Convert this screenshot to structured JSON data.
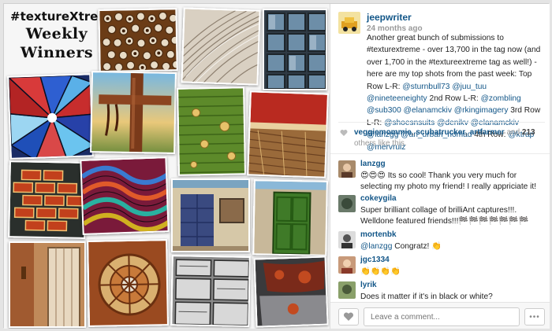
{
  "collage": {
    "title_line1": "#textureXtreme",
    "title_line2": "Weekly",
    "title_line3": "Winners"
  },
  "post": {
    "author": "jeepwriter",
    "time_ago": "24 months ago",
    "caption_parts": [
      {
        "t": "Another great bunch of submissions to #texturextreme - over 13,700 in the tag now (and over 1,700 in the #textureextreme tag as well!) - here are my top shots from the past week: Top Row L-R: ",
        "m": false
      },
      {
        "t": "@sturnbull73",
        "m": true
      },
      {
        "t": " ",
        "m": false
      },
      {
        "t": "@juu_tuu",
        "m": true
      },
      {
        "t": " ",
        "m": false
      },
      {
        "t": "@nineteeneighty",
        "m": true
      },
      {
        "t": " 2nd Row L-R: ",
        "m": false
      },
      {
        "t": "@zombling",
        "m": true
      },
      {
        "t": " ",
        "m": false
      },
      {
        "t": "@sub300",
        "m": true
      },
      {
        "t": " ",
        "m": false
      },
      {
        "t": "@elanamckiv",
        "m": true
      },
      {
        "t": " ",
        "m": false
      },
      {
        "t": "@rkingimagery",
        "m": true
      },
      {
        "t": " 3rd Row L-R: ",
        "m": false
      },
      {
        "t": "@shoesnsuits",
        "m": true
      },
      {
        "t": " ",
        "m": false
      },
      {
        "t": "@denikv",
        "m": true
      },
      {
        "t": " ",
        "m": false
      },
      {
        "t": "@elanamckiv",
        "m": true
      },
      {
        "t": " ",
        "m": false
      },
      {
        "t": "@lanzgg",
        "m": true
      },
      {
        "t": " ",
        "m": false
      },
      {
        "t": "@an_urban_nomad",
        "m": true
      },
      {
        "t": " 4th Row: ",
        "m": false
      },
      {
        "t": "@ktrap",
        "m": true
      },
      {
        "t": " ",
        "m": false
      },
      {
        "t": "@mervruiz",
        "m": true
      }
    ]
  },
  "likes": {
    "user1": "veggiemommie",
    "sep1": ", ",
    "user2": "scubatrucker",
    "sep2": ", ",
    "user3": "artfarmer",
    "and_text": " and ",
    "count": "213",
    "others_text": " others like this."
  },
  "comments": [
    {
      "name": "lanzgg",
      "text": "😍😍😍 Its so cool! Thank you very much for selecting my photo my friend! I really appriciate it!"
    },
    {
      "name": "cokeygila",
      "text": "Super brilliant collage of brilliAnt captures!!!. Welldone featured friends!!!🏁🏁🏁🏁🏁🏁🏁"
    },
    {
      "name": "mortenbk",
      "mention": "@lanzgg",
      "text": " Congratz! 👏"
    },
    {
      "name": "jgc1334",
      "text": "👏👏👏👏"
    },
    {
      "name": "lyrik",
      "text": "Does it matter if it's in black or white?"
    }
  ],
  "input": {
    "placeholder": "Leave a comment...",
    "more_label": "•••"
  },
  "colors": {
    "link": "#125688",
    "muted": "#999999"
  }
}
